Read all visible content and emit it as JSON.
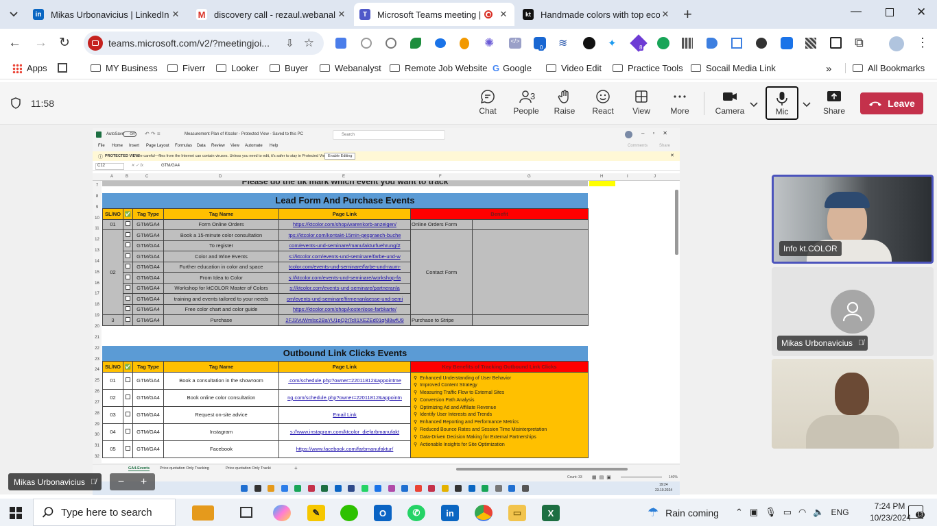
{
  "browser": {
    "tabs": [
      {
        "title": "Mikas Urbonavicius | LinkedIn",
        "favicon": "linkedin-icon"
      },
      {
        "title": "discovery call - rezaul.webanal",
        "favicon": "gmail-icon"
      },
      {
        "title": "Microsoft Teams meeting |",
        "favicon": "teams-icon"
      },
      {
        "title": "Handmade colors with top eco",
        "favicon": "ktcolor-icon"
      }
    ],
    "url": "teams.microsoft.com/v2/?meetingjoi...",
    "bookmarks": [
      "Apps",
      "MY Business",
      "Fiverr",
      "Looker",
      "Buyer",
      "Webanalyst",
      "Remote Job Website",
      "Google",
      "Video Edit",
      "Practice Tools",
      "Socail Media Link",
      "All Bookmarks"
    ],
    "extension_badges": [
      "0",
      "8"
    ]
  },
  "meeting": {
    "timer": "11:58",
    "controls": {
      "chat": "Chat",
      "people": "People",
      "people_count": "3",
      "raise": "Raise",
      "react": "React",
      "view": "View",
      "more": "More",
      "camera": "Camera",
      "mic": "Mic",
      "share": "Share",
      "leave": "Leave"
    },
    "participants": [
      {
        "name": "Info kt.COLOR"
      },
      {
        "name": "Mikas Urbonavicius"
      },
      {
        "name": ""
      }
    ],
    "presenter_name": "Mikas Urbonavicius"
  },
  "excel": {
    "title": "Measurement Plan of Ktcolor - Protected View - Saved to this PC",
    "autosave": "AutoSave",
    "autosave_state": "Off",
    "search": "Search",
    "menu": [
      "File",
      "Home",
      "Insert",
      "Page Layout",
      "Formulas",
      "Data",
      "Review",
      "View",
      "Automate",
      "Help"
    ],
    "comments": "Comments",
    "share": "Share",
    "protected_label": "PROTECTED VIEW",
    "protected_msg": "Be careful—files from the Internet can contain viruses. Unless you need to edit, it's safer to stay in Protected View.",
    "enable_editing": "Enable Editing",
    "cell_ref": "C12",
    "formula": "GTM/GA4",
    "col_letters": [
      "A",
      "B",
      "C",
      "D",
      "E",
      "F",
      "G",
      "H",
      "I",
      "J"
    ],
    "row_numbers": [
      "7",
      "8",
      "9",
      "10",
      "11",
      "12",
      "13",
      "14",
      "15",
      "16",
      "17",
      "18",
      "19",
      "20",
      "21",
      "22",
      "23",
      "24",
      "25",
      "26",
      "27",
      "28",
      "29",
      "30",
      "31",
      "32"
    ],
    "top_banner": "Please do the tik mark which event you want to track",
    "lead": {
      "title": "Lead Form And Purchase Events",
      "headers": [
        "SL/NO",
        "✅",
        "Tag Type",
        "Tag Name",
        "Page Link",
        "Benefit"
      ],
      "rows": [
        {
          "sl": "01",
          "type": "GTM/GA4",
          "name": "Form Online Orders",
          "link": "https://ktcolor.com/shop/warenkorb-anzeigen/",
          "benefit": "Online Orders Form"
        },
        {
          "sl": "",
          "type": "GTM/GA4",
          "name": "Book a 15-minute color consultation",
          "link": "tps://ktcolor.com/kontakt-15min-gespraech-buche",
          "benefit": ""
        },
        {
          "sl": "",
          "type": "GTM/GA4",
          "name": "To register",
          "link": "com/events-und-seminare/manufakturfuehrung/#",
          "benefit": ""
        },
        {
          "sl": "",
          "type": "GTM/GA4",
          "name": "Color and Wine Events",
          "link": "s://ktcolor.com/events-und-seminare/farbe-und-w",
          "benefit": ""
        },
        {
          "sl": "",
          "type": "GTM/GA4",
          "name": "Further education in color and space",
          "link": "tcolor.com/events-und-seminare/farbe-und-raum-",
          "benefit": ""
        },
        {
          "sl": "",
          "type": "GTM/GA4",
          "name": "From Idea to Color",
          "link": "s://ktcolor.com/events-und-seminare/workshop-fa",
          "benefit": ""
        },
        {
          "sl": "",
          "type": "GTM/GA4",
          "name": "Workshop for ktCOLOR Master of Colors",
          "link": "s://ktcolor.com/events-und-seminare/partneranla",
          "benefit": ""
        },
        {
          "sl": "",
          "type": "GTM/GA4",
          "name": "training and events tailored to your needs",
          "link": "om/events-und-seminare/firmenanlaesse-und-semi",
          "benefit": ""
        },
        {
          "sl": "",
          "type": "GTM/GA4",
          "name": "Free color chart and color guide",
          "link": "https://ktcolor.com/shop/kostenlose-farbkarte/",
          "benefit": ""
        },
        {
          "sl": "3",
          "type": "GTM/GA4",
          "name": "Purchase",
          "link": "2FJ3VuWmlsc2BaYU1pQ2tTclI1XEZEd01qNl8wfU9",
          "benefit": "Purchase to Stripe"
        }
      ],
      "group_sl": "02",
      "group_benefit": "Contact Form"
    },
    "outbound": {
      "title": "Outbound Link Clicks Events",
      "headers": [
        "SL/NO",
        "✅",
        "Tag Type",
        "Tag Name",
        "Page Link",
        "Key Benefits of Tracking Outbound Link Clicks"
      ],
      "rows": [
        {
          "sl": "01",
          "type": "GTM/GA4",
          "name": "Book a consultation in the showroom",
          "link": ".com/schedule.php?owner=22011812&appointme"
        },
        {
          "sl": "02",
          "type": "GTM/GA4",
          "name": "Book online color consultation",
          "link": "ng.com/schedule.php?owner=22011812&appointn"
        },
        {
          "sl": "03",
          "type": "GTM/GA4",
          "name": "Request on-site advice",
          "link": "Email Link"
        },
        {
          "sl": "04",
          "type": "GTM/GA4",
          "name": "Instagram",
          "link": "s://www.instagram.com/ktcolor_diefarbmanufakt"
        },
        {
          "sl": "05",
          "type": "GTM/GA4",
          "name": "Facebook",
          "link": "https://www.facebook.com/farbmanufaktur/"
        }
      ],
      "benefits": [
        "Enhanced Understanding of User Behavior",
        "Improved Content Strategy",
        "Measuring Traffic Flow to External Sites",
        "Conversion Path Analysis",
        "Optimizing Ad and Affiliate Revenue",
        "Identify User Interests and Trends",
        "Enhanced Reporting and Performance Metrics",
        "Reduced Bounce Rates and Session Time Misinterpretation",
        "Data-Driven Decision Making for External Partnerships",
        "Actionable Insights for Site Optimization"
      ]
    },
    "sheet_tabs": [
      "GA4-Events",
      "Price quotation Only Tracking",
      "Price quotation Only Tracki"
    ],
    "status_count": "Count: 33",
    "zoom": "140%",
    "inner_clock_time": "19:24",
    "inner_clock_date": "23.10.2024"
  },
  "taskbar": {
    "search_placeholder": "Type here to search",
    "weather": "Rain coming",
    "lang": "ENG",
    "time": "7:24 PM",
    "date": "10/23/2024",
    "notification_count": "13"
  },
  "colors": {
    "lead_title_bg": "#5b9bd5",
    "header_yellow": "#ffc000",
    "benefit_red": "#ff0000",
    "row_gray": "#bfbfbf",
    "leave_red": "#c4314b",
    "teams_purple": "#4b53bc",
    "link_blue": "#1a0dab"
  }
}
